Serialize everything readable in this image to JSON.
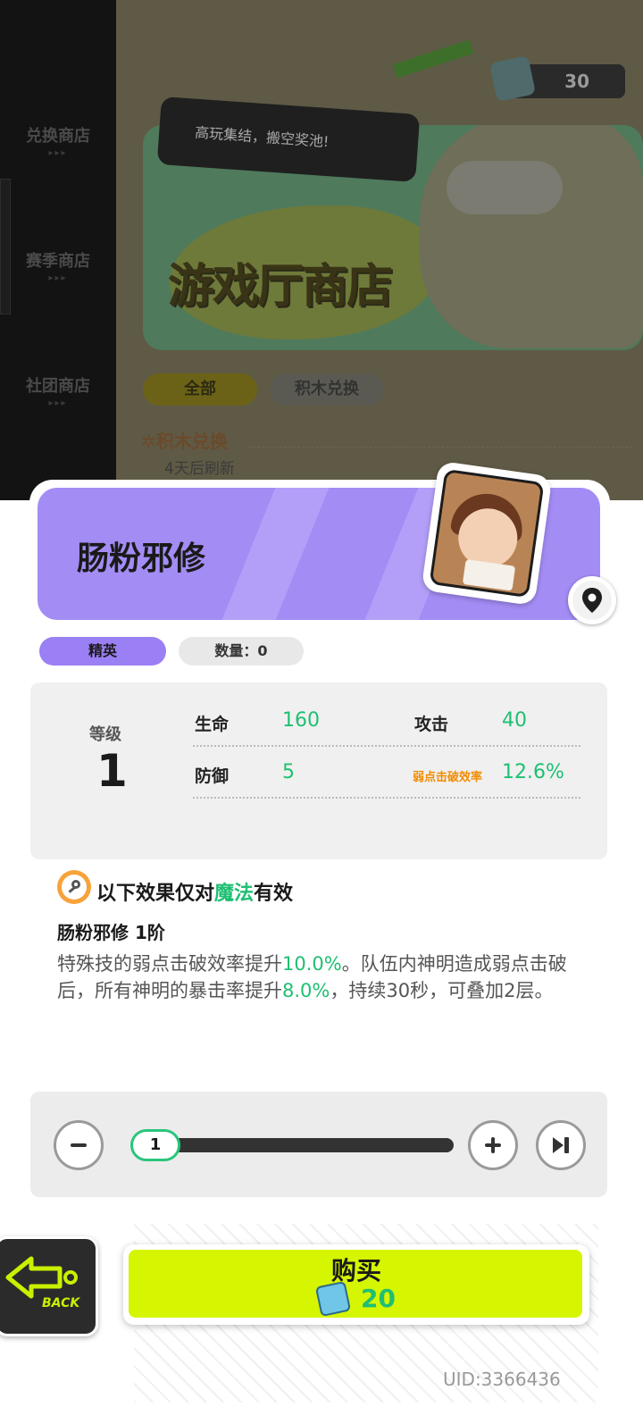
{
  "sidebar": {
    "items": [
      {
        "label": "兑换商店"
      },
      {
        "label": "赛季商店"
      },
      {
        "label": "社团商店"
      }
    ]
  },
  "banner": {
    "speech": "高玩集结，搬空奖池!",
    "title": "游戏厅商店"
  },
  "currency": {
    "amount": "30"
  },
  "shop_tabs": [
    {
      "label": "全部",
      "active": true
    },
    {
      "label": "积木兑换",
      "active": false
    }
  ],
  "section": {
    "title": "积木兑换",
    "refresh": "4天后刷新"
  },
  "item": {
    "name": "肠粉邪修",
    "rank": "精英",
    "quantity_text": "数量：0",
    "level_label": "等级",
    "level": "1",
    "stats": {
      "hp_label": "生命",
      "hp": "160",
      "atk_label": "攻击",
      "atk": "40",
      "def_label": "防御",
      "def": "5",
      "weak_label": "弱点击破效率",
      "weak": "12.6%"
    }
  },
  "effect": {
    "prefix": "以下效果仅对",
    "highlight": "魔法",
    "suffix": "有效",
    "skill_name": "肠粉邪修 1阶",
    "desc": [
      {
        "t": "特殊技的弱点击破效率提升",
        "hl": false
      },
      {
        "t": "10.0%",
        "hl": true
      },
      {
        "t": "。队伍内神明造成弱点击破后，所有神明的暴击率提升",
        "hl": false
      },
      {
        "t": "8.0%",
        "hl": true
      },
      {
        "t": "，持续30秒，可叠加2层。",
        "hl": false
      }
    ]
  },
  "purchase": {
    "count": "1",
    "count_fraction": 0.0,
    "back_label": "BACK",
    "buy_label": "购买",
    "price": "20"
  },
  "footer": {
    "uid": "UID:3366436"
  },
  "colors": {
    "accent_purple": "#a48cf5",
    "buy_yellow": "#d6f500",
    "value_green": "#1fbf73",
    "weak_orange": "#f28c00"
  },
  "icons": [
    "location-pin-icon",
    "key-icon",
    "minus-icon",
    "plus-icon",
    "skip-to-max-icon",
    "back-arrow-icon",
    "block-cube-icon"
  ]
}
